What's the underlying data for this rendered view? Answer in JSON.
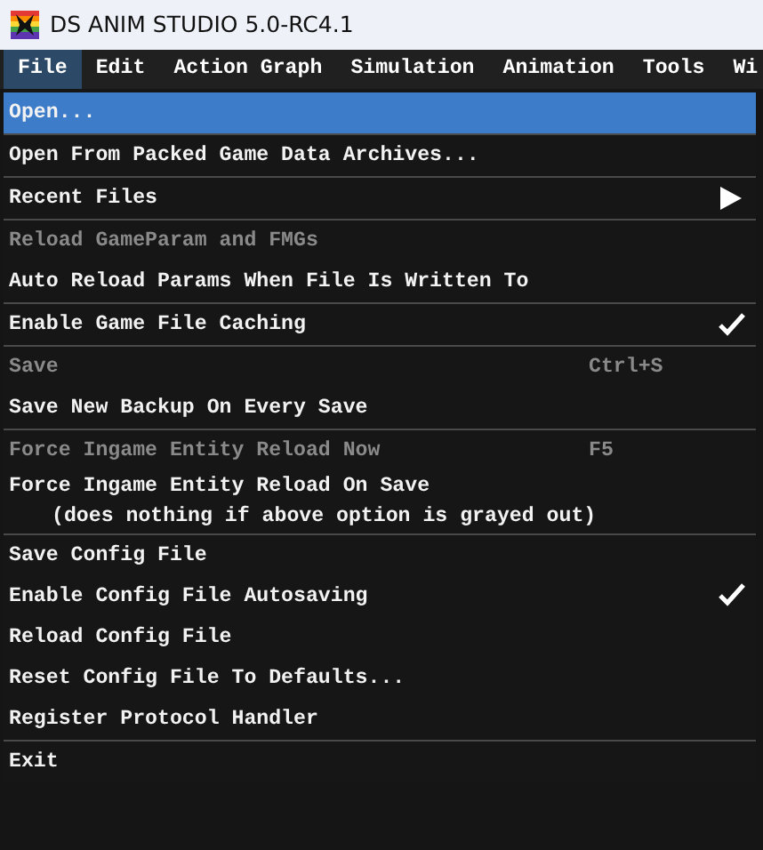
{
  "window": {
    "title": "DS ANIM STUDIO 5.0-RC4.1"
  },
  "menu_bar": [
    {
      "label": "File",
      "selected": true
    },
    {
      "label": "Edit",
      "selected": false
    },
    {
      "label": "Action Graph",
      "selected": false
    },
    {
      "label": "Simulation",
      "selected": false
    },
    {
      "label": "Animation",
      "selected": false
    },
    {
      "label": "Tools",
      "selected": false
    },
    {
      "label": "Wi",
      "selected": false
    }
  ],
  "file_menu": {
    "groups": [
      [
        {
          "kind": "action",
          "label": "Open...",
          "selected": true,
          "disabled": false
        }
      ],
      [
        {
          "kind": "action",
          "label": "Open From Packed Game Data Archives...",
          "selected": false,
          "disabled": false
        }
      ],
      [
        {
          "kind": "submenu",
          "label": "Recent Files",
          "selected": false,
          "disabled": false
        }
      ],
      [
        {
          "kind": "action",
          "label": "Reload GameParam and FMGs",
          "selected": false,
          "disabled": true
        },
        {
          "kind": "toggle",
          "label": "Auto Reload Params When File Is Written To",
          "selected": false,
          "disabled": false,
          "checked": false
        }
      ],
      [
        {
          "kind": "toggle",
          "label": "Enable Game File Caching",
          "selected": false,
          "disabled": false,
          "checked": true
        }
      ],
      [
        {
          "kind": "action",
          "label": "Save",
          "shortcut": "Ctrl+S",
          "selected": false,
          "disabled": true
        },
        {
          "kind": "toggle",
          "label": "Save New Backup On Every Save",
          "selected": false,
          "disabled": false,
          "checked": false
        }
      ],
      [
        {
          "kind": "action",
          "label": "Force Ingame Entity Reload Now",
          "shortcut": "F5",
          "selected": false,
          "disabled": true
        },
        {
          "kind": "toggle",
          "label": "Force Ingame Entity Reload On Save",
          "note": "(does nothing if above option is grayed out)",
          "selected": false,
          "disabled": false,
          "checked": false
        }
      ],
      [
        {
          "kind": "action",
          "label": "Save Config File",
          "selected": false,
          "disabled": false
        },
        {
          "kind": "toggle",
          "label": "Enable Config File Autosaving",
          "selected": false,
          "disabled": false,
          "checked": true
        },
        {
          "kind": "action",
          "label": "Reload Config File",
          "selected": false,
          "disabled": false
        },
        {
          "kind": "action",
          "label": "Reset Config File To Defaults...",
          "selected": false,
          "disabled": false
        },
        {
          "kind": "action",
          "label": "Register Protocol Handler",
          "selected": false,
          "disabled": false
        }
      ],
      [
        {
          "kind": "action",
          "label": "Exit",
          "selected": false,
          "disabled": false
        }
      ]
    ]
  }
}
